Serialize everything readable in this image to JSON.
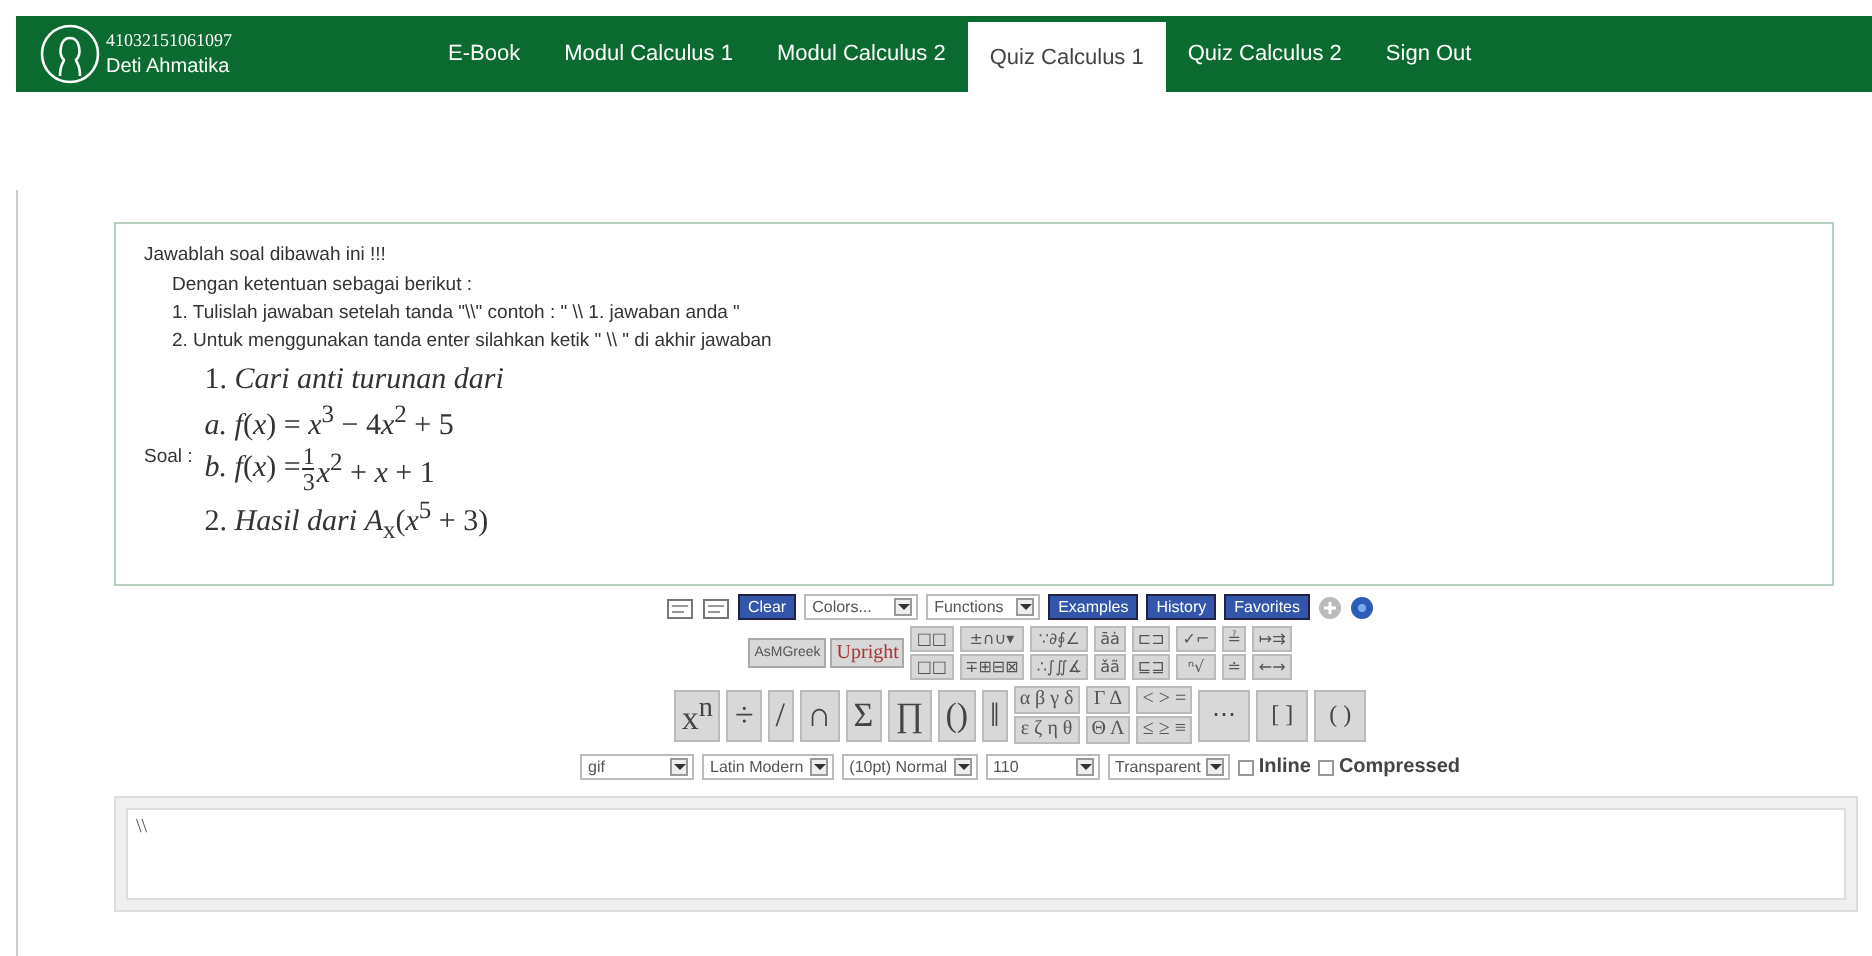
{
  "user": {
    "id": "41032151061097",
    "name": "Deti Ahmatika"
  },
  "nav": [
    {
      "label": "E-Book",
      "selected": false
    },
    {
      "label": "Modul Calculus 1",
      "selected": false
    },
    {
      "label": "Modul Calculus 2",
      "selected": false
    },
    {
      "label": "Quiz Calculus 1",
      "selected": true
    },
    {
      "label": "Quiz Calculus 2",
      "selected": false
    },
    {
      "label": "Sign Out",
      "selected": false
    }
  ],
  "instructions": {
    "heading": "Jawablah soal dibawah ini !!!",
    "intro": "Dengan ketentuan sebagai berikut :",
    "rules": [
      "1. Tulislah jawaban setelah tanda \"\\\\\" contoh : \" \\\\ 1. jawaban anda \"",
      "2. Untuk menggunakan tanda enter silahkan ketik \" \\\\ \" di akhir jawaban"
    ]
  },
  "question": {
    "label": "Soal :",
    "lines": [
      {
        "kind": "text",
        "text": "1. *Cari anti turunan dari*"
      },
      {
        "kind": "segments",
        "segments": [
          "*a.* *f*(*x*) = *x*$^{3}$ − 4",
          "*x*$^{2}$ + 5"
        ]
      },
      {
        "kind": "fraction",
        "before": "*b.* *f*(*x*) = ",
        "numerator": "1",
        "denominator": "3",
        "after": "*x*$^{2}$ + *x* + 1"
      },
      {
        "kind": "text",
        "text": "2. *Hasil dari* *A*$_{x}$(*x*$^{5}$ + 3)"
      }
    ]
  },
  "editor": {
    "top": [
      {
        "kind": "icon"
      },
      {
        "kind": "icon"
      },
      {
        "kind": "button",
        "label": "Clear"
      },
      {
        "kind": "select",
        "label": "Colors..."
      },
      {
        "kind": "select",
        "label": "Functions"
      },
      {
        "kind": "button",
        "label": "Examples"
      },
      {
        "kind": "button",
        "label": "History"
      },
      {
        "kind": "button",
        "label": "Favorites"
      },
      {
        "kind": "plus"
      },
      {
        "kind": "help"
      }
    ],
    "modes": [
      "AsMGreek",
      "Upright"
    ],
    "small_groups": [
      [
        "□□",
        "□□"
      ],
      [
        "±∩∪▾",
        "∓⊞⊟⊠"
      ],
      [
        "∵∂∮∠",
        "∴∫∬∡"
      ],
      [
        "āȧ",
        "ǎã"
      ],
      [
        "⊏⊐",
        "⊑⊒"
      ],
      [
        "✓⌐",
        "ⁿ√"
      ],
      [
        "≟",
        "≐"
      ],
      [
        "↦⇉",
        "←→"
      ]
    ],
    "big": [
      "x$^{n}$",
      "÷",
      "/",
      "∩",
      "Σ",
      "∏",
      "()",
      "‖"
    ],
    "greek": [
      [
        "α β γ δ",
        "ε ζ η θ"
      ],
      [
        "Γ Δ",
        "Θ Λ"
      ],
      [
        "< > =",
        "≤ ≥ ≡"
      ]
    ],
    "matrix": [
      "⋯",
      "[ ]",
      "( )"
    ],
    "bottom": [
      {
        "kind": "select",
        "label": "gif"
      },
      {
        "kind": "select",
        "label": "Latin Modern"
      },
      {
        "kind": "select",
        "label": "(10pt) Normal"
      },
      {
        "kind": "select",
        "label": "110"
      },
      {
        "kind": "select",
        "label": "Transparent"
      },
      {
        "kind": "check",
        "label": "Inline",
        "checked": false
      },
      {
        "kind": "check",
        "label": "Compressed",
        "checked": false
      }
    ]
  },
  "answer": {
    "value": "\\\\"
  }
}
